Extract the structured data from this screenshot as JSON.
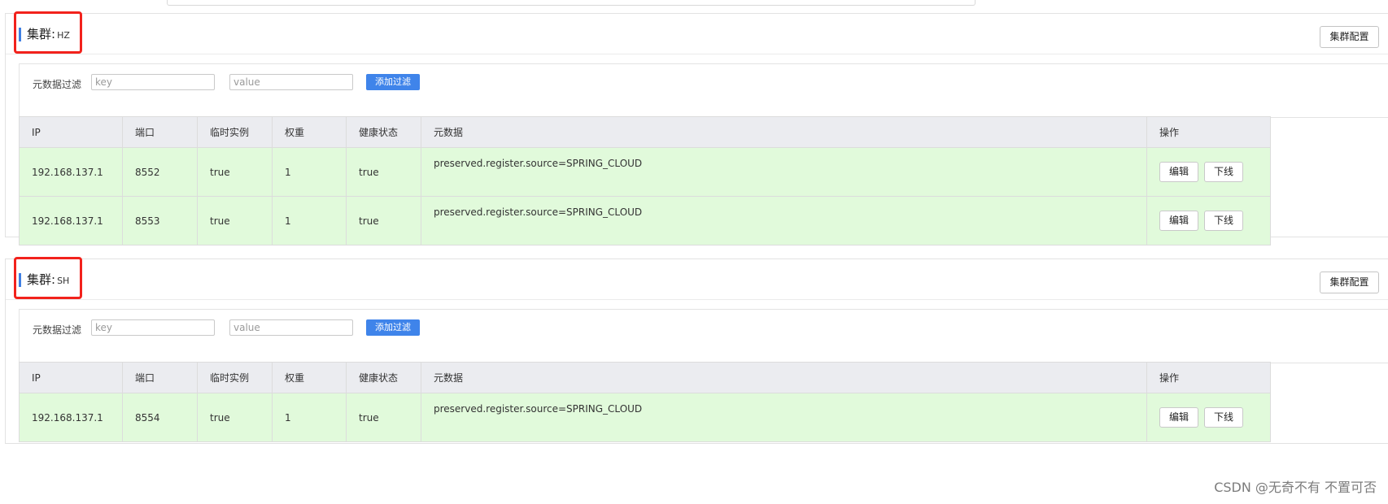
{
  "clusters": [
    {
      "label": "集群:",
      "name": "HZ",
      "config_button": "集群配置",
      "filter": {
        "label": "元数据过滤",
        "key_placeholder": "key",
        "value_placeholder": "value",
        "add_button": "添加过滤"
      },
      "columns": [
        "IP",
        "端口",
        "临时实例",
        "权重",
        "健康状态",
        "元数据",
        "操作"
      ],
      "rows": [
        {
          "ip": "192.168.137.1",
          "port": "8552",
          "ephemeral": "true",
          "weight": "1",
          "healthy": "true",
          "metadata": "preserved.register.source=SPRING_CLOUD",
          "edit": "编辑",
          "offline": "下线"
        },
        {
          "ip": "192.168.137.1",
          "port": "8553",
          "ephemeral": "true",
          "weight": "1",
          "healthy": "true",
          "metadata": "preserved.register.source=SPRING_CLOUD",
          "edit": "编辑",
          "offline": "下线"
        }
      ]
    },
    {
      "label": "集群:",
      "name": "SH",
      "config_button": "集群配置",
      "filter": {
        "label": "元数据过滤",
        "key_placeholder": "key",
        "value_placeholder": "value",
        "add_button": "添加过滤"
      },
      "columns": [
        "IP",
        "端口",
        "临时实例",
        "权重",
        "健康状态",
        "元数据",
        "操作"
      ],
      "rows": [
        {
          "ip": "192.168.137.1",
          "port": "8554",
          "ephemeral": "true",
          "weight": "1",
          "healthy": "true",
          "metadata": "preserved.register.source=SPRING_CLOUD",
          "edit": "编辑",
          "offline": "下线"
        }
      ]
    }
  ],
  "watermark": "CSDN @无奇不有 不置可否",
  "colors": {
    "accent": "#3f7fe3",
    "primary_button": "#3f84ea",
    "row_background": "#e1fadb",
    "header_background": "#ebecf0",
    "highlight_border": "#f2221c"
  }
}
